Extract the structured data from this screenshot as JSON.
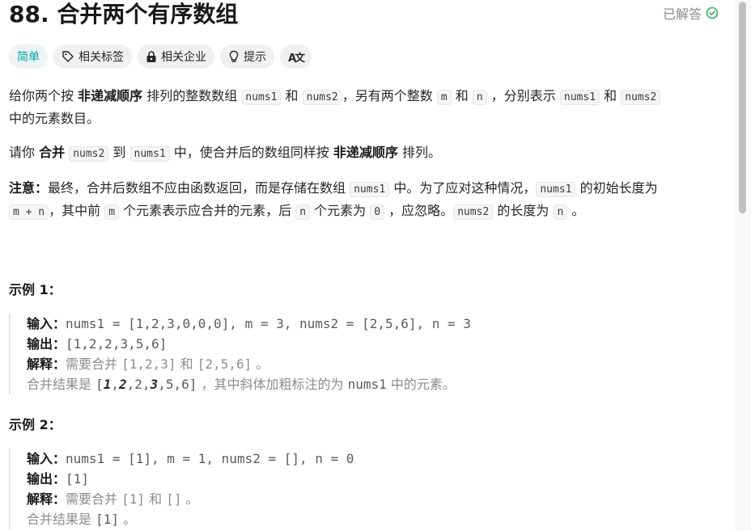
{
  "problem": {
    "title": "88. 合并两个有序数组",
    "status": "已解答"
  },
  "tags": {
    "difficulty": "简单",
    "related_tags": "相关标签",
    "related_companies": "相关企业",
    "hints": "提示",
    "translate_glyph": "A文"
  },
  "desc": {
    "p1": {
      "a": "给你两个按 ",
      "b": "非递减顺序",
      "c": " 排列的整数数组 ",
      "code1": "nums1",
      "d": " 和 ",
      "code2": "nums2",
      "e": "，另有两个整数 ",
      "code3": "m",
      "f": " 和 ",
      "code4": "n",
      "g": " ，分别表示 ",
      "code5": "nums1",
      "h": " 和 ",
      "code6": "nums2",
      "i": " 中的元素数目。"
    },
    "p2": {
      "a": "请你 ",
      "b": "合并",
      "c": " ",
      "code1": "nums2",
      "d": " 到 ",
      "code2": "nums1",
      "e": " 中，使合并后的数组同样按 ",
      "f": "非递减顺序",
      "g": " 排列。"
    },
    "p3": {
      "label": "注意：",
      "a": "最终，合并后数组不应由函数返回，而是存储在数组 ",
      "code1": "nums1",
      "b": " 中。为了应对这种情况，",
      "code2": "nums1",
      "c": " 的初始长度为 ",
      "code3": "m + n",
      "d": "，其中前 ",
      "code4": "m",
      "e": " 个元素表示应合并的元素，后 ",
      "code5": "n",
      "f": " 个元素为 ",
      "code6": "0",
      "g": " ，应忽略。",
      "code7": "nums2",
      "h": " 的长度为 ",
      "code8": "n",
      "i": " 。"
    }
  },
  "examples": [
    {
      "title": "示例 1：",
      "input_label": "输入：",
      "input": "nums1 = [1,2,3,0,0,0], m = 3, nums2 = [2,5,6], n = 3",
      "output_label": "输出：",
      "output": "[1,2,2,3,5,6]",
      "explain_label": "解释：",
      "explain_a": "需要合并 ",
      "explain_b": "[1,2,3]",
      "explain_c": " 和 ",
      "explain_d": "[2,5,6]",
      "explain_e": " 。",
      "result_a": "合并结果是 ",
      "result_open": "[",
      "result_b1": "1",
      "result_sep1": ",",
      "result_b2": "2",
      "result_mid": ",2,",
      "result_b3": "3",
      "result_end": ",5,6]",
      "result_c": " ，其中斜体加粗标注的为 ",
      "result_d": "nums1",
      "result_e": " 中的元素。"
    },
    {
      "title": "示例 2：",
      "input_label": "输入：",
      "input": "nums1 = [1], m = 1, nums2 = [], n = 0",
      "output_label": "输出：",
      "output": "[1]",
      "explain_label": "解释：",
      "explain_a": "需要合并 ",
      "explain_b": "[1]",
      "explain_c": " 和 ",
      "explain_d": "[]",
      "explain_e": " 。",
      "result_a": "合并结果是 ",
      "result_b": "[1]",
      "result_c": " 。"
    }
  ],
  "colors": {
    "accent_easy": "#00a6a6",
    "solved_check": "#2db55d"
  }
}
